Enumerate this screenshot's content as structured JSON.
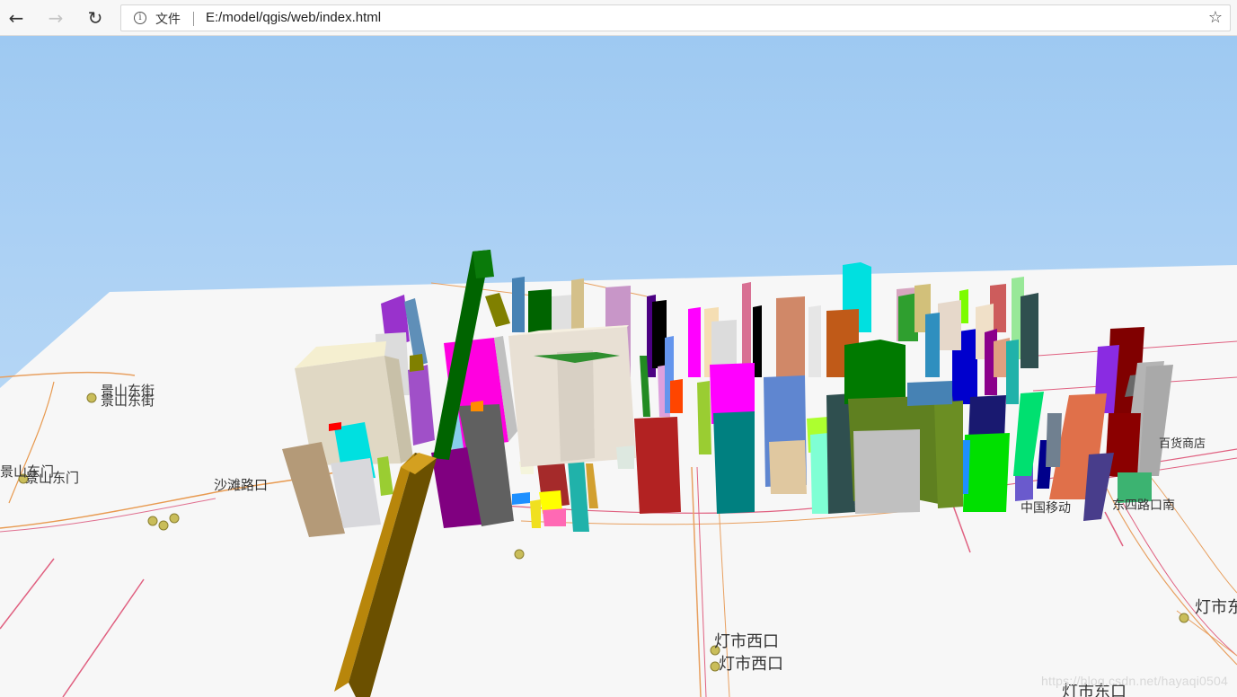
{
  "browser": {
    "back_icon": "←",
    "forward_icon": "→",
    "refresh_icon": "↻",
    "info_icon": "i",
    "file_label": "文件",
    "url": "E:/model/qgis/web/index.html",
    "star_icon": "☆"
  },
  "map": {
    "labels": {
      "jingshan_dongjie_1": "景山东街",
      "jingshan_dongjie_2": "景山东街",
      "jingshan_dongmen_1": "景山东门",
      "jingshan_dongmen_2": "景山东门",
      "shatan_lukou": "沙滩路口",
      "dengshi_xikou_1": "灯市西口",
      "dengshi_xikou_2": "灯市西口",
      "dengshi_dongkou": "灯市东口",
      "dengshi_partial": "灯市东",
      "china_mobile": "中国移动",
      "dongsi_lukou_nan": "东四路口南",
      "store": "百货商店"
    }
  },
  "watermark": "https://blog.csdn.net/hayaqi0504"
}
